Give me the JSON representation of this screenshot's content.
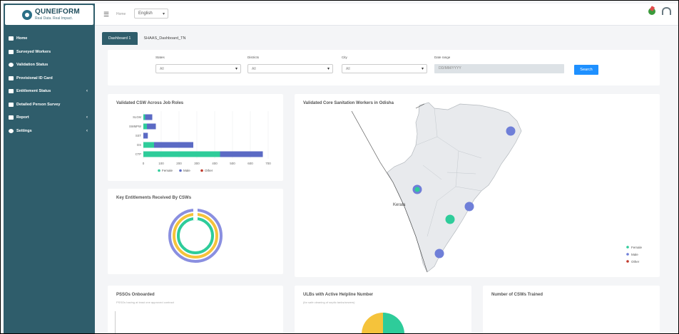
{
  "colors": {
    "sidebar": "#2f5d6b",
    "female": "#2ecc9a",
    "male": "#5b6ac4",
    "other": "#c0392b",
    "accent": "#1e90ff",
    "yellow": "#f5c33b"
  },
  "logo": {
    "name": "QUNEIFORM",
    "tagline": "Real Data. Real Impact."
  },
  "sidebar": {
    "items": [
      {
        "label": "Home",
        "icon": "home-icon",
        "caret": false
      },
      {
        "label": "Surveyed Workers",
        "icon": "list-icon",
        "caret": false
      },
      {
        "label": "Validation Status",
        "icon": "check-circle-icon",
        "caret": false
      },
      {
        "label": "Provisional ID Card",
        "icon": "id-card-icon",
        "caret": false
      },
      {
        "label": "Entitlement Status",
        "icon": "document-icon",
        "caret": true
      },
      {
        "label": "Detailed Person Survey",
        "icon": "survey-icon",
        "caret": false
      },
      {
        "label": "Report",
        "icon": "report-icon",
        "caret": true
      },
      {
        "label": "Settings",
        "icon": "gear-icon",
        "caret": true
      }
    ]
  },
  "topbar": {
    "home": "Home",
    "language": "English"
  },
  "tabs": [
    {
      "label": "Dashboard 1",
      "active": true
    },
    {
      "label": "SHAAS_Dashboard_TN",
      "active": false
    }
  ],
  "filters": {
    "states": {
      "label": "States",
      "value": "All"
    },
    "districts": {
      "label": "Districts",
      "value": "All"
    },
    "city": {
      "label": "City",
      "value": "All"
    },
    "date_range": {
      "label": "Date range",
      "value": "DD/MM/YYYY"
    },
    "search_label": "Search"
  },
  "cards": {
    "job_roles": {
      "title": "Validated CSW Across Job Roles"
    },
    "entitlements": {
      "title": "Key Entitlements Received By CSWs"
    },
    "map": {
      "title": "Validated Core Sanitation Workers in Odisha",
      "region_label": "Kerala",
      "legend": [
        "Female",
        "Male",
        "Other"
      ]
    },
    "pssos": {
      "title": "PSSOs Onboarded",
      "subtitle": "PSSOs having at least one approved contract"
    },
    "ulbs": {
      "title": "ULBs with Active Helpline Number",
      "subtitle": "(for safe cleaning of septic tanks/sewers)"
    },
    "trained": {
      "title": "Number of CSWs Trained"
    }
  },
  "chart_data": {
    "type": "bar",
    "orientation": "horizontal",
    "stacked": true,
    "categories": [
      "SLGM",
      "SWMPW",
      "SST",
      "DS",
      "CTP"
    ],
    "series": [
      {
        "name": "Female",
        "color": "#2ecc9a",
        "values": [
          10,
          20,
          0,
          60,
          430
        ]
      },
      {
        "name": "Male",
        "color": "#5b6ac4",
        "values": [
          40,
          50,
          25,
          220,
          240
        ]
      },
      {
        "name": "Other",
        "color": "#c0392b",
        "values": [
          0,
          0,
          0,
          0,
          0
        ]
      }
    ],
    "x_ticks": [
      "0",
      "100",
      "200",
      "300",
      "400",
      "500",
      "600",
      "700"
    ],
    "xlim": [
      0,
      700
    ],
    "grid": true,
    "legend": "bottom"
  }
}
